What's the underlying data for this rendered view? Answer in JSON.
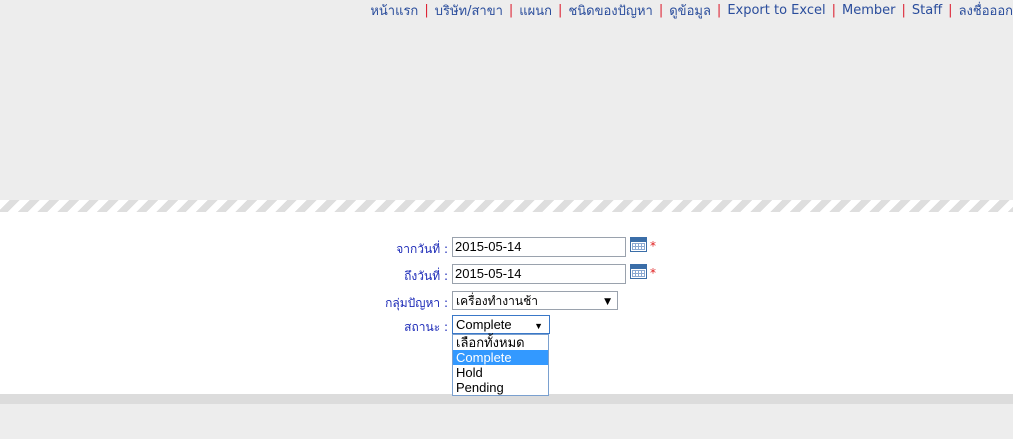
{
  "nav": {
    "items": [
      "หน้าแรก",
      "บริษัท/สาขา",
      "แผนก",
      "ชนิดของปัญหา",
      "ดูข้อมูล",
      "Export to Excel",
      "Member",
      "Staff",
      "ลงชื่อออก"
    ],
    "separator": "|"
  },
  "form": {
    "from_date_label": "จากวันที่ :",
    "from_date_value": "2015-05-14",
    "to_date_label": "ถึงวันที่ :",
    "to_date_value": "2015-05-14",
    "group_label": "กลุ่มปัญหา :",
    "group_value": "เครื่องทำงานช้า",
    "status_label": "สถานะ :",
    "status_value": "Complete",
    "required_mark": "*",
    "status_options": [
      "เลือกทั้งหมด",
      "Complete",
      "Hold",
      "Pending"
    ],
    "status_selected_index": 1
  },
  "icons": {
    "calendar": "calendar-icon",
    "dropdown_arrow": "▼"
  },
  "colors": {
    "nav_link": "#2a4d9c",
    "separator": "#dd2233",
    "label": "#1d2bb8",
    "highlight": "#3399ff"
  }
}
